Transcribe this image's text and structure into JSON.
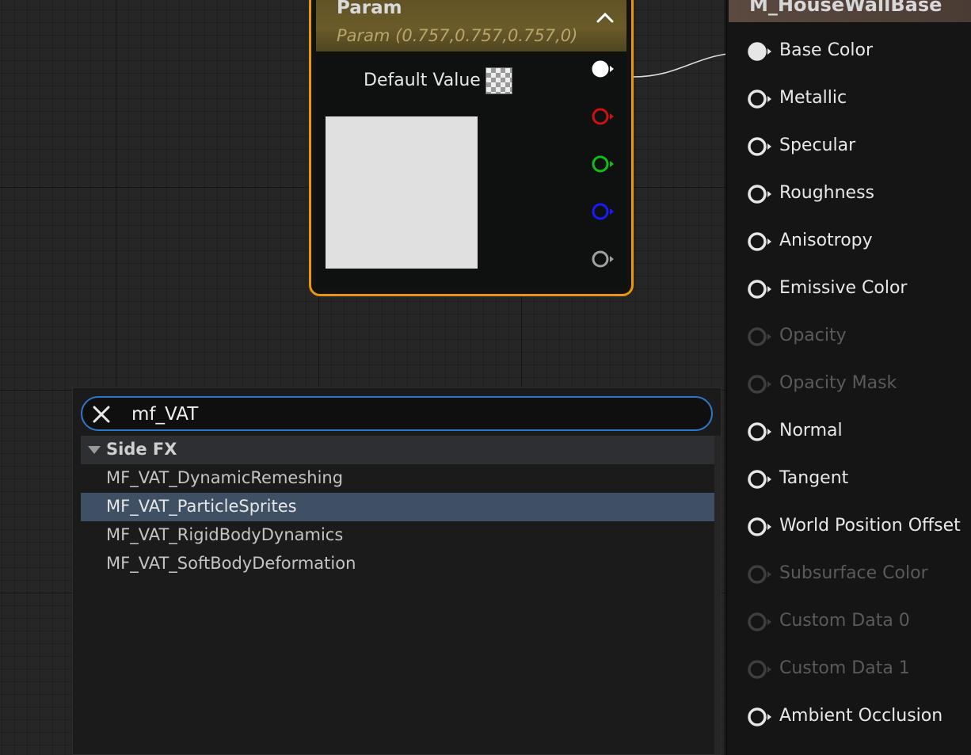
{
  "param_node": {
    "title": "Param",
    "subtitle": "Param (0.757,0.757,0.757,0)",
    "default_value_label": "Default Value",
    "preview_color": "#e0e0e0",
    "accent_color": "#e8960c",
    "output_pins": [
      {
        "name": "rgba",
        "color": "#ffffff",
        "connected": true
      },
      {
        "name": "r",
        "color": "#d01010",
        "connected": false
      },
      {
        "name": "g",
        "color": "#10c010",
        "connected": false
      },
      {
        "name": "b",
        "color": "#1a1aff",
        "connected": false
      },
      {
        "name": "a",
        "color": "#a0a0a0",
        "connected": false
      }
    ]
  },
  "result_node": {
    "title": "M_HouseWallBase",
    "inputs": [
      {
        "label": "Base Color",
        "enabled": true,
        "connected": true
      },
      {
        "label": "Metallic",
        "enabled": true,
        "connected": false
      },
      {
        "label": "Specular",
        "enabled": true,
        "connected": false
      },
      {
        "label": "Roughness",
        "enabled": true,
        "connected": false
      },
      {
        "label": "Anisotropy",
        "enabled": true,
        "connected": false
      },
      {
        "label": "Emissive Color",
        "enabled": true,
        "connected": false
      },
      {
        "label": "Opacity",
        "enabled": false,
        "connected": false
      },
      {
        "label": "Opacity Mask",
        "enabled": false,
        "connected": false
      },
      {
        "label": "Normal",
        "enabled": true,
        "connected": false
      },
      {
        "label": "Tangent",
        "enabled": true,
        "connected": false
      },
      {
        "label": "World Position Offset",
        "enabled": true,
        "connected": false
      },
      {
        "label": "Subsurface Color",
        "enabled": false,
        "connected": false
      },
      {
        "label": "Custom Data 0",
        "enabled": false,
        "connected": false
      },
      {
        "label": "Custom Data 1",
        "enabled": false,
        "connected": false
      },
      {
        "label": "Ambient Occlusion",
        "enabled": true,
        "connected": false
      }
    ]
  },
  "search": {
    "query": "mf_VAT",
    "category": "Side FX",
    "results": [
      {
        "label": "MF_VAT_DynamicRemeshing",
        "selected": false
      },
      {
        "label": "MF_VAT_ParticleSprites",
        "selected": true
      },
      {
        "label": "MF_VAT_RigidBodyDynamics",
        "selected": false
      },
      {
        "label": "MF_VAT_SoftBodyDeformation",
        "selected": false
      }
    ]
  }
}
